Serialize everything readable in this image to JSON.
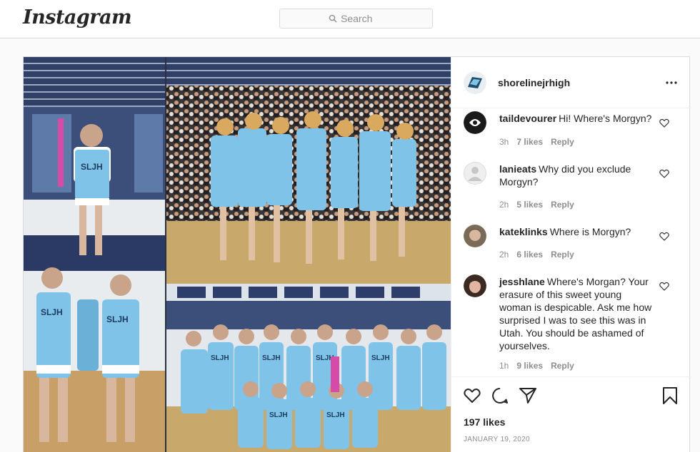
{
  "header": {
    "logo_text": "Instagram",
    "search": {
      "placeholder": "Search",
      "icon": "search-icon"
    }
  },
  "post": {
    "author": {
      "username": "shorelinejrhigh",
      "avatar": "school-logo-avatar"
    },
    "menu_icon": "more-options-icon",
    "photo": {
      "description_labels": [
        "SLJH",
        "SLJH",
        "SLJH",
        "SLJH",
        "SLJH",
        "SLJH",
        "SLJH"
      ],
      "colors": {
        "uniform": "#7fc4e8",
        "court": "#c9a86b",
        "bleachers": "#2b3a5c",
        "banner": "#3b4f7a"
      }
    },
    "comments": [
      {
        "username": "taildevourer",
        "text": "Hi! Where's Morgyn?",
        "time": "3h",
        "likes": "7 likes",
        "reply": "Reply"
      },
      {
        "username": "lanieats",
        "text": "Why did you exclude Morgyn?",
        "time": "2h",
        "likes": "5 likes",
        "reply": "Reply"
      },
      {
        "username": "kateklinks",
        "text": "Where is Morgyn?",
        "time": "2h",
        "likes": "6 likes",
        "reply": "Reply"
      },
      {
        "username": "jesshlane",
        "text": "Where's Morgan? Your erasure of this sweet young woman is despicable. Ask me how surprised I was to see this was in Utah. You should be ashamed of yourselves.",
        "time": "1h",
        "likes": "9 likes",
        "reply": "Reply"
      }
    ],
    "actions": {
      "like_icon": "heart-icon",
      "comment_icon": "comment-icon",
      "share_icon": "share-icon",
      "save_icon": "bookmark-icon"
    },
    "likes_text": "197 likes",
    "date": "JANUARY 19, 2020"
  },
  "colors": {
    "accent": "#262626",
    "muted": "#8e8e8e",
    "border": "#dbdbdb",
    "background": "#fafafa"
  }
}
